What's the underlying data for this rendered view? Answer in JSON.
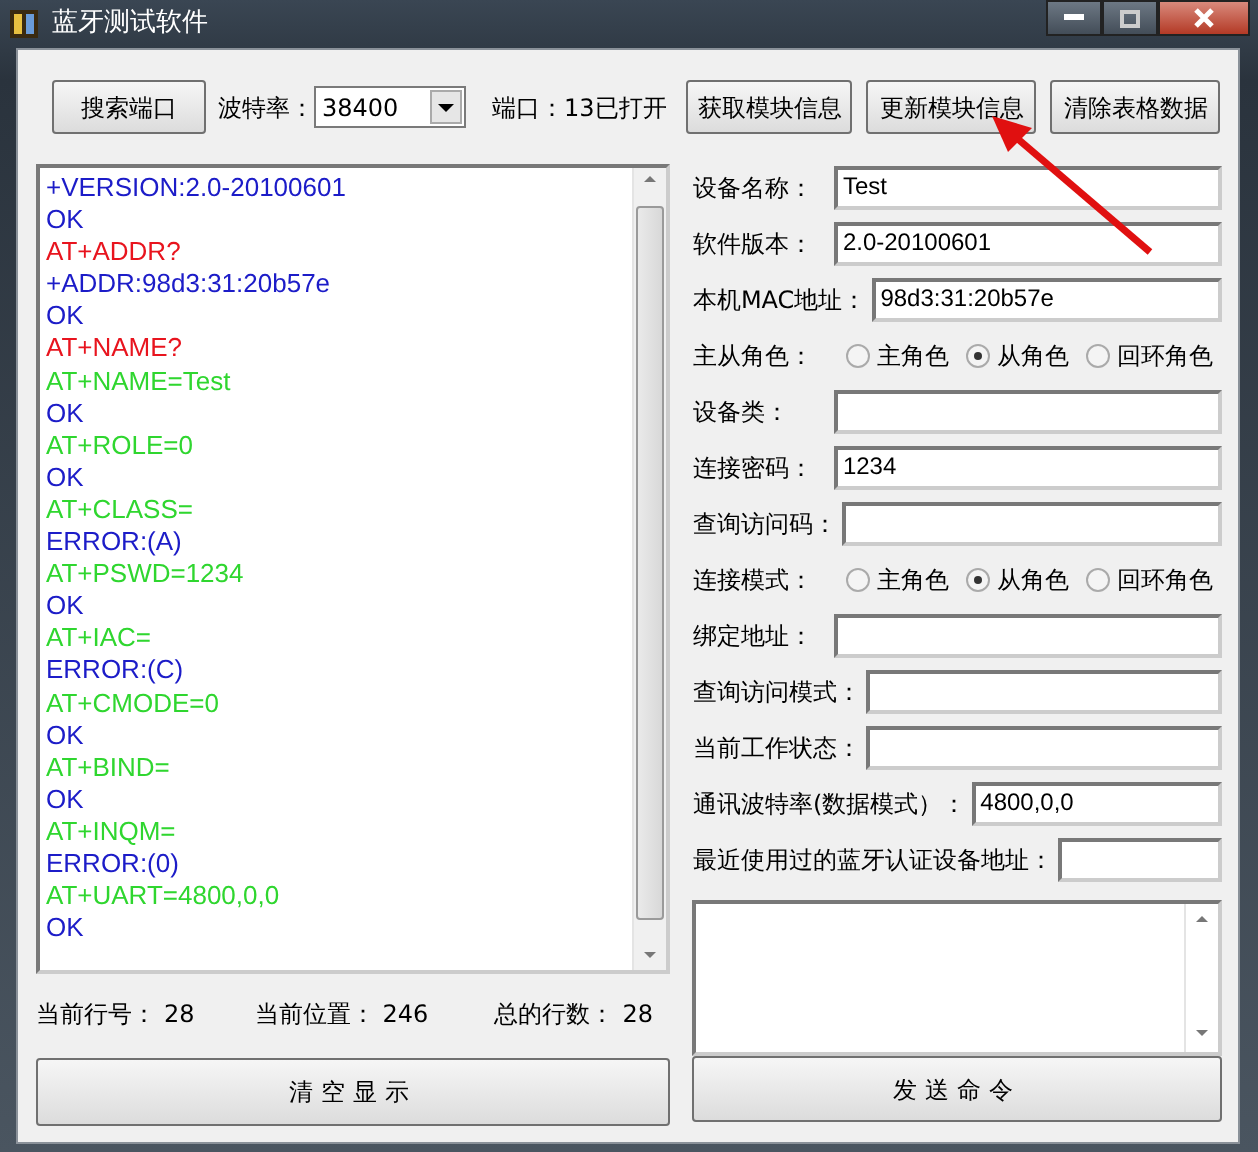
{
  "window": {
    "title": "蓝牙测试软件"
  },
  "toolbar": {
    "search_button": "搜索端口",
    "baud_label": "波特率：",
    "baud_value": "38400",
    "port_status": "端口：13已打开",
    "buttons": [
      "获取模块信息",
      "更新模块信息",
      "清除表格数据"
    ]
  },
  "log": [
    {
      "kind": "response",
      "text": "+VERSION:2.0-20100601"
    },
    {
      "kind": "response",
      "text": "OK"
    },
    {
      "kind": "query",
      "text": "AT+ADDR?"
    },
    {
      "kind": "response",
      "text": "+ADDR:98d3:31:20b57e"
    },
    {
      "kind": "response",
      "text": "OK"
    },
    {
      "kind": "query",
      "text": "AT+NAME?"
    },
    {
      "kind": "command",
      "text": "AT+NAME=Test"
    },
    {
      "kind": "response",
      "text": "OK"
    },
    {
      "kind": "command",
      "text": "AT+ROLE=0"
    },
    {
      "kind": "response",
      "text": "OK"
    },
    {
      "kind": "command",
      "text": "AT+CLASS="
    },
    {
      "kind": "response",
      "text": "ERROR:(A)"
    },
    {
      "kind": "command",
      "text": "AT+PSWD=1234"
    },
    {
      "kind": "response",
      "text": "OK"
    },
    {
      "kind": "command",
      "text": "AT+IAC="
    },
    {
      "kind": "response",
      "text": "ERROR:(C)"
    },
    {
      "kind": "command",
      "text": "AT+CMODE=0"
    },
    {
      "kind": "response",
      "text": "OK"
    },
    {
      "kind": "command",
      "text": "AT+BIND="
    },
    {
      "kind": "response",
      "text": "OK"
    },
    {
      "kind": "command",
      "text": "AT+INQM="
    },
    {
      "kind": "response",
      "text": "ERROR:(0)"
    },
    {
      "kind": "command",
      "text": "AT+UART=4800,0,0"
    },
    {
      "kind": "response",
      "text": "OK"
    }
  ],
  "status": [
    {
      "label": "当前行号：",
      "value": "28"
    },
    {
      "label": "当前位置：",
      "value": "246"
    },
    {
      "label": "总的行数：",
      "value": "28"
    }
  ],
  "clear_button": "清空显示",
  "form": [
    {
      "kind": "field",
      "label": "设备名称：",
      "value": "Test"
    },
    {
      "kind": "field",
      "label": "软件版本：",
      "value": "2.0-20100601"
    },
    {
      "kind": "field",
      "label": "本机MAC地址：",
      "value": "98d3:31:20b57e"
    },
    {
      "kind": "radio",
      "label": "主从角色：",
      "options": [
        {
          "label": "主角色",
          "selected": false
        },
        {
          "label": "从角色",
          "selected": true
        },
        {
          "label": "回环角色",
          "selected": false
        }
      ]
    },
    {
      "kind": "field",
      "label": "设备类："
    },
    {
      "kind": "field",
      "label": "连接密码：",
      "value": "1234"
    },
    {
      "kind": "field",
      "label": "查询访问码："
    },
    {
      "kind": "radio",
      "label": "连接模式：",
      "options": [
        {
          "label": "主角色",
          "selected": false
        },
        {
          "label": "从角色",
          "selected": true
        },
        {
          "label": "回环角色",
          "selected": false
        }
      ]
    },
    {
      "kind": "field",
      "label": "绑定地址："
    },
    {
      "kind": "field",
      "label": "查询访问模式："
    },
    {
      "kind": "field",
      "label": "当前工作状态："
    },
    {
      "kind": "field",
      "label": "通讯波特率(数据模式）：",
      "value": "4800,0,0"
    },
    {
      "kind": "field",
      "label": "最近使用过的蓝牙认证设备地址："
    }
  ],
  "send_button": "发送命令"
}
